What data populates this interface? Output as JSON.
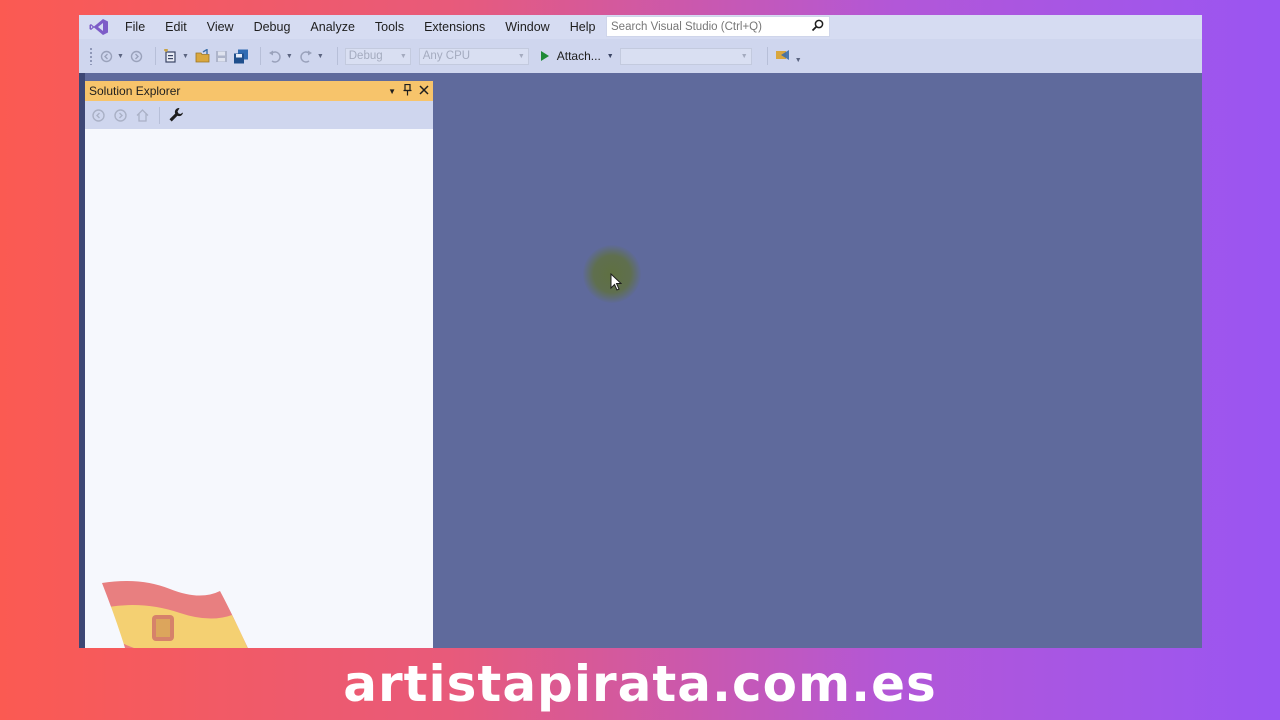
{
  "menu": {
    "items": [
      "File",
      "Edit",
      "View",
      "Debug",
      "Analyze",
      "Tools",
      "Extensions",
      "Window",
      "Help"
    ]
  },
  "search": {
    "placeholder": "Search Visual Studio (Ctrl+Q)"
  },
  "toolbar": {
    "config": "Debug",
    "platform": "Any CPU",
    "attach_label": "Attach...",
    "target": ""
  },
  "solution_explorer": {
    "title": "Solution Explorer"
  },
  "watermark": {
    "text": "artistapirata.com.es"
  },
  "colors": {
    "editor_bg": "#5f6a9c",
    "menubar_bg": "#d6dcf2",
    "panel_title_bg": "#f7c46b",
    "vs_purple": "#7d5cc8"
  }
}
